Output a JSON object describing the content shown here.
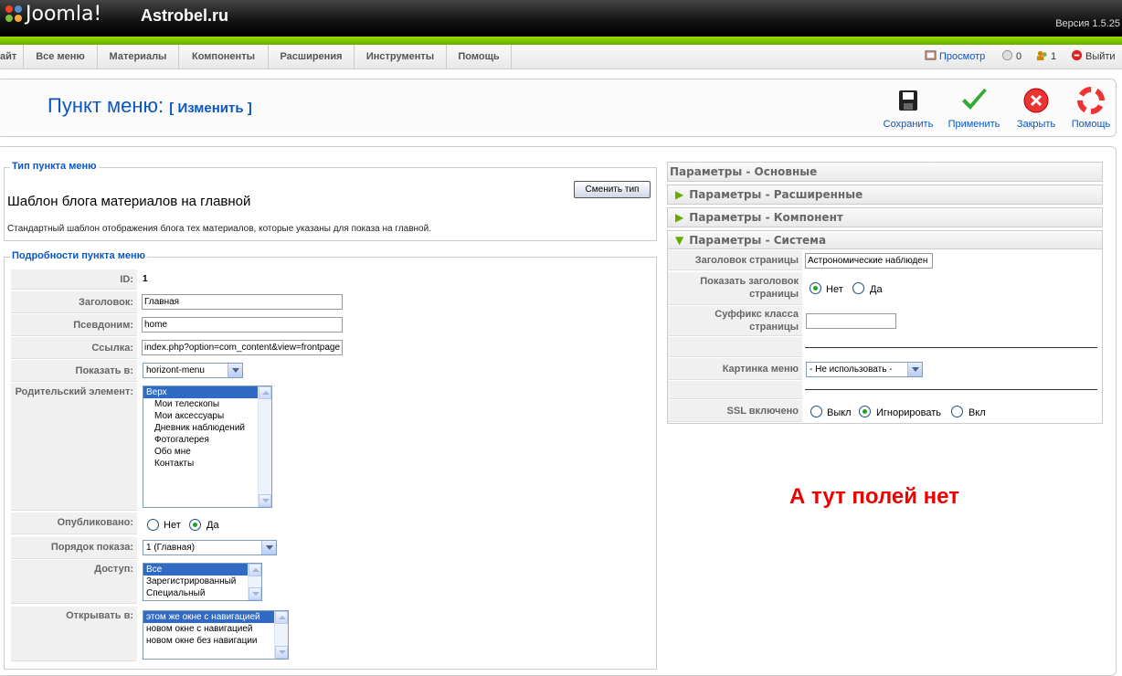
{
  "header": {
    "logo": "Joomla!",
    "site": "Astrobel.ru",
    "version": "Версия 1.5.25"
  },
  "menu": {
    "items": [
      "айт",
      "Все меню",
      "Материалы",
      "Компоненты",
      "Расширения",
      "Инструменты",
      "Помощь"
    ],
    "preview": "Просмотр",
    "messages": "0",
    "users": "1",
    "logout": "Выйти"
  },
  "page": {
    "title": "Пункт меню:",
    "subtitle": "[ Изменить ]"
  },
  "toolbar": {
    "save": "Сохранить",
    "apply": "Применить",
    "close": "Закрыть",
    "help": "Помощь"
  },
  "menu_type": {
    "legend": "Тип пункта меню",
    "title": "Шаблон блога материалов на главной",
    "description": "Стандартный шаблон отображения блога тех материалов, которые указаны для показа на главной.",
    "change_button": "Сменить тип"
  },
  "details": {
    "legend": "Подробности пункта меню",
    "id_label": "ID:",
    "id_value": "1",
    "title_label": "Заголовок:",
    "title_value": "Главная",
    "alias_label": "Псевдоним:",
    "alias_value": "home",
    "link_label": "Ссылка:",
    "link_value": "index.php?option=com_content&view=frontpage",
    "display_in_label": "Показать в:",
    "display_in_value": "horizont-menu",
    "parent_label": "Родительский элемент:",
    "parent_options": [
      "Верх",
      "Мои телескопы",
      "Мои аксессуары",
      "Дневник наблюдений",
      "Фотогалерея",
      "Обо мне",
      "Контакты"
    ],
    "published_label": "Опубликовано:",
    "no": "Нет",
    "yes": "Да",
    "order_label": "Порядок показа:",
    "order_value": "1 (Главная)",
    "access_label": "Доступ:",
    "access_options": [
      "Все",
      "Зарегистрированный",
      "Специальный"
    ],
    "target_label": "Открывать в:",
    "target_options": [
      "этом же окне с навигацией",
      "новом окне с навигацией",
      "новом окне без навигации"
    ]
  },
  "params": {
    "basic": "Параметры - Основные",
    "advanced": "Параметры - Расширенные",
    "component": "Параметры - Компонент",
    "system": "Параметры - Система",
    "page_title_label": "Заголовок страницы",
    "page_title_value": "Астрономические наблюден",
    "show_title_label": "Показать заголовок страницы",
    "show_no": "Нет",
    "show_yes": "Да",
    "suffix_label": "Суффикс класса страницы",
    "image_label": "Картинка меню",
    "image_value": "- Не использовать -",
    "ssl_label": "SSL включено",
    "ssl_off": "Выкл",
    "ssl_ignore": "Игнорировать",
    "ssl_on": "Вкл"
  },
  "note": "А тут полей нет"
}
